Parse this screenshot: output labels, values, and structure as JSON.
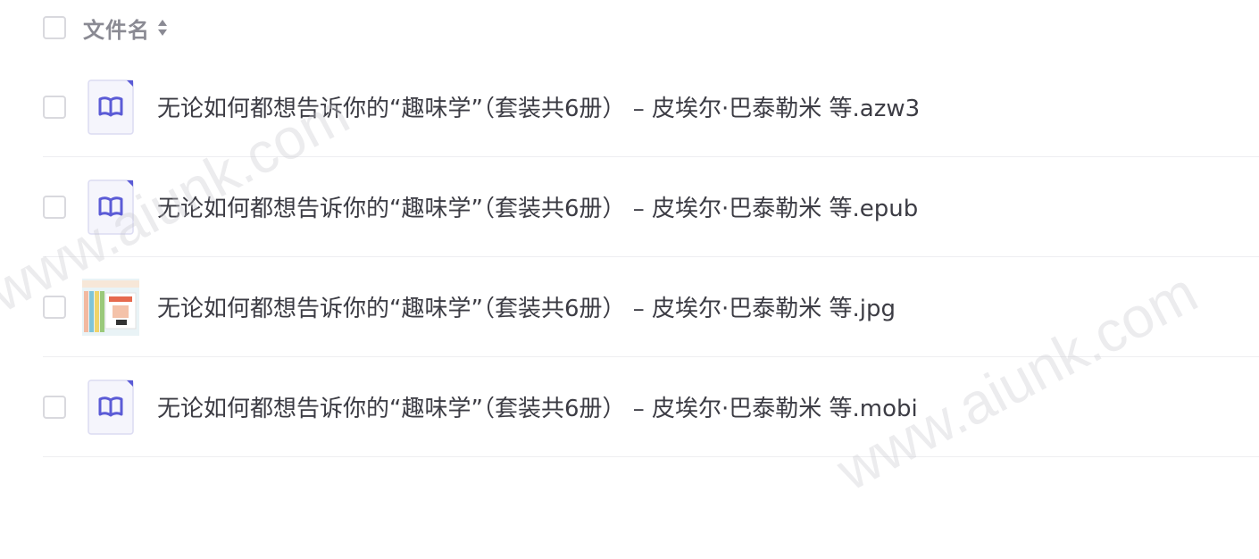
{
  "header": {
    "column_label": "文件名",
    "sort_icon": "sort-icon"
  },
  "files": [
    {
      "name": "无论如何都想告诉你的“趣味学”（套装共6册） – 皮埃尔·巴泰勒米 等.azw3",
      "icon": "book-icon"
    },
    {
      "name": "无论如何都想告诉你的“趣味学”（套装共6册） – 皮埃尔·巴泰勒米 等.epub",
      "icon": "book-icon"
    },
    {
      "name": "无论如何都想告诉你的“趣味学”（套装共6册） – 皮埃尔·巴泰勒米 等.jpg",
      "icon": "image-thumbnail"
    },
    {
      "name": "无论如何都想告诉你的“趣味学”（套装共6册） – 皮埃尔·巴泰勒米 等.mobi",
      "icon": "book-icon"
    }
  ],
  "watermark": {
    "text": "www.aiunk.com"
  },
  "colors": {
    "icon_accent": "#5b5bd6",
    "icon_bg": "#f3f3fb",
    "text": "#3c3c44",
    "header_text": "#8a8a93",
    "divider": "#eeeef1"
  }
}
